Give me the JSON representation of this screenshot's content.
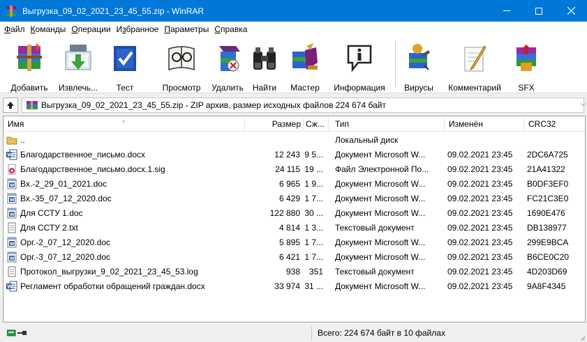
{
  "window": {
    "title": "Выгрузка_09_02_2021_23_45_55.zip - WinRAR",
    "accent": "#0078d7"
  },
  "menu": [
    {
      "label": "Файл",
      "u": "Ф",
      "rest": "айл"
    },
    {
      "label": "Команды",
      "u": "К",
      "rest": "оманды"
    },
    {
      "label": "Операции",
      "u": "О",
      "rest": "перации"
    },
    {
      "label": "Избранное",
      "u": "з",
      "pre": "И",
      "rest": "бранное"
    },
    {
      "label": "Параметры",
      "u": "П",
      "rest": "араметры"
    },
    {
      "label": "Справка",
      "u": "С",
      "rest": "правка"
    }
  ],
  "toolbar": [
    {
      "label": "Добавить",
      "icon": "add-archive-icon"
    },
    {
      "label": "Извлечь...",
      "icon": "extract-icon"
    },
    {
      "label": "Тест",
      "icon": "test-icon"
    },
    {
      "label": "Просмотр",
      "icon": "view-icon"
    },
    {
      "label": "Удалить",
      "icon": "delete-icon"
    },
    {
      "label": "Найти",
      "icon": "find-icon"
    },
    {
      "label": "Мастер",
      "icon": "wizard-icon"
    },
    {
      "label": "Информация",
      "icon": "info-icon"
    },
    {
      "label": "Вирусы",
      "icon": "virus-scan-icon"
    },
    {
      "label": "Комментарий",
      "icon": "comment-icon"
    },
    {
      "label": "SFX",
      "icon": "sfx-icon"
    }
  ],
  "pathbar": {
    "text": "Выгрузка_09_02_2021_23_45_55.zip - ZIP архив, размер исходных файлов 224 674 байт"
  },
  "columns": {
    "name": "Имя",
    "size": "Размер",
    "packed": "Сж...",
    "type": "Тип",
    "modified": "Изменён",
    "crc": "CRC32"
  },
  "files": [
    {
      "name": "..",
      "size": "",
      "packed": "",
      "type": "Локальный диск",
      "modified": "",
      "crc": "",
      "icon": "parent-folder-icon"
    },
    {
      "name": "Благодарственное_письмо.docx",
      "size": "12 243",
      "packed": "9 5...",
      "type": "Документ Microsoft W...",
      "modified": "09.02.2021 23:45",
      "crc": "2DC6A725",
      "icon": "word-docx-icon"
    },
    {
      "name": "Благодарственное_письмо.docx.1.sig",
      "size": "24 115",
      "packed": "19 ...",
      "type": "Файл Электронной По...",
      "modified": "09.02.2021 23:45",
      "crc": "21A41322",
      "icon": "signature-file-icon"
    },
    {
      "name": "Вх.-2_29_01_2021.doc",
      "size": "6 965",
      "packed": "1 9...",
      "type": "Документ Microsoft W...",
      "modified": "09.02.2021 23:45",
      "crc": "B0DF3EF0",
      "icon": "word-doc-icon"
    },
    {
      "name": "Вх.-35_07_12_2020.doc",
      "size": "6 429",
      "packed": "1 7...",
      "type": "Документ Microsoft W...",
      "modified": "09.02.2021 23:45",
      "crc": "FC21C3E0",
      "icon": "word-doc-icon"
    },
    {
      "name": "Для ССТУ 1.doc",
      "size": "122 880",
      "packed": "30 ...",
      "type": "Документ Microsoft W...",
      "modified": "09.02.2021 23:45",
      "crc": "1690E476",
      "icon": "word-doc-icon"
    },
    {
      "name": "Для ССТУ 2.txt",
      "size": "4 814",
      "packed": "1 3...",
      "type": "Текстовый документ",
      "modified": "09.02.2021 23:45",
      "crc": "DB138977",
      "icon": "text-file-icon"
    },
    {
      "name": "Орг.-2_07_12_2020.doc",
      "size": "5 895",
      "packed": "1 7...",
      "type": "Документ Microsoft W...",
      "modified": "09.02.2021 23:45",
      "crc": "299E9BCA",
      "icon": "word-doc-icon"
    },
    {
      "name": "Орг.-3_07_12_2020.doc",
      "size": "6 421",
      "packed": "1 7...",
      "type": "Документ Microsoft W...",
      "modified": "09.02.2021 23:45",
      "crc": "B6CE0C20",
      "icon": "word-doc-icon"
    },
    {
      "name": "Протокол_выгрузки_9_02_2021_23_45_53.log",
      "size": "938",
      "packed": "351",
      "type": "Текстовый документ",
      "modified": "09.02.2021 23:45",
      "crc": "4D203D69",
      "icon": "text-file-icon"
    },
    {
      "name": "Регламент обработки обращений граждан.docx",
      "size": "33 974",
      "packed": "31 ...",
      "type": "Документ Microsoft W...",
      "modified": "09.02.2021 23:45",
      "crc": "9A8F4345",
      "icon": "word-docx-icon"
    }
  ],
  "status": {
    "total": "Всего: 224 674 байт в 10 файлах"
  }
}
